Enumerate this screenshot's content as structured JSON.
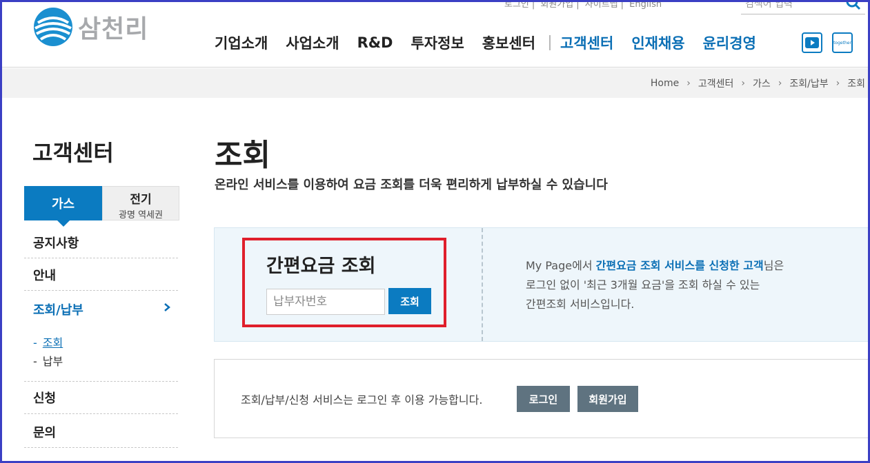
{
  "header": {
    "logo_text": "삼천리",
    "util_links": [
      "로그인",
      "회원가입",
      "사이트맵",
      "English"
    ],
    "search_placeholder": "검색어 입력",
    "gnb": [
      "기업소개",
      "사업소개",
      "R&D",
      "투자정보",
      "홍보센터",
      "고객센터",
      "인재채용",
      "윤리경영"
    ],
    "sns": [
      "youtube-icon",
      "together-icon"
    ],
    "together_label": "together"
  },
  "breadcrumb": [
    "Home",
    "고객센터",
    "가스",
    "조회/납부",
    "조회"
  ],
  "sidebar": {
    "title": "고객센터",
    "tab_gas": "가스",
    "tab_elec_title": "전기",
    "tab_elec_sub": "광명 역세권",
    "items": [
      "공지사항",
      "안내",
      "조회/납부",
      "신청",
      "문의"
    ],
    "sub_items": [
      "조회",
      "납부"
    ]
  },
  "main": {
    "title": "조회",
    "description": "온라인 서비스를 이용하여 요금 조회를 더욱 편리하게 납부하실 수 있습니다",
    "quick": {
      "title": "간편요금 조회",
      "input_placeholder": "납부자번호",
      "button": "조회",
      "info_prefix": "My Page에서 ",
      "info_highlight": "간편요금 조회 서비스를 신청한 고객",
      "info_suffix": "님은",
      "info_line2": "로그인 없이 '최근 3개월 요금'을 조회 하실 수 있는",
      "info_line3": "간편조회 서비스입니다."
    },
    "login_notice": "조회/납부/신청 서비스는 로그인 후 이용 가능합니다.",
    "login_button": "로그인",
    "join_button": "회원가입"
  },
  "colors": {
    "accent": "#0b7bc1",
    "highlight_border": "#e01f2b",
    "frame": "#3b3fc4"
  }
}
